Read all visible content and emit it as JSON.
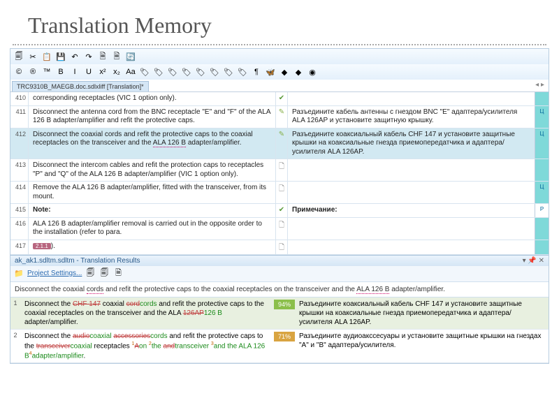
{
  "title": "Translation Memory",
  "file_tab": "TRC9310B_MAEGB.doc.sdlxliff [Translation]*",
  "toolbar_icons": [
    "🗐",
    "✂",
    "📋",
    "💾",
    "↶",
    "↷",
    "🗎",
    "🗎",
    "🔄",
    "©",
    "®",
    "™",
    "B",
    "I",
    "U",
    "x²",
    "x₂",
    "Aa",
    "🏷",
    "🏷",
    "🏷",
    "🏷",
    "🏷",
    "🏷",
    "🏷",
    "🏷",
    "¶",
    "🦋",
    "◆",
    "◆",
    "◉"
  ],
  "rows": [
    {
      "num": "410",
      "src": "corresponding receptacles (VIC 1 option only).",
      "mark": "✔",
      "tgt": "",
      "stat": ""
    },
    {
      "num": "411",
      "src": "Disconnect the antenna cord from the BNC receptacle \"E\" and \"F\" of the ALA 126 B adapter/amplifier and refit the protective caps.",
      "mark": "✎",
      "tgt": "Разъедините кабель антенны с гнездом BNC \"E\" адаптера/усилителя ALA 126AP и установите защитную крышку.",
      "stat": "Ц",
      "alt": false
    },
    {
      "num": "412",
      "src": "Disconnect the coaxial cords and refit the protective caps to the coaxial receptacles on the transceiver and the <u>ALA 126 B</u> adapter/amplifier.",
      "mark": "✎",
      "tgt": "Разъедините коаксиальный кабель CHF 147 и установите защитные крышки на коаксиальные гнезда приемопередатчика и адаптера/усилителя ALA 126AP.",
      "stat": "Ц",
      "alt": true
    },
    {
      "num": "413",
      "src": "Disconnect the intercom cables and refit the protection caps to receptacles \"P\" and \"Q\" of the ALA 126 B adapter/amplifier (VIC 1 option only).",
      "mark": "🗋",
      "tgt": "",
      "stat": "",
      "alt": false
    },
    {
      "num": "414",
      "src": "Remove the ALA 126 B adapter/amplifier, fitted with the transceiver, from its mount.",
      "mark": "🗋",
      "tgt": "",
      "stat": "Ц",
      "alt": false
    },
    {
      "num": "415",
      "src": "<b>Note:</b>",
      "mark": "✔",
      "tgt": "<b>Примечание:</b>",
      "stat": "P",
      "alt": false,
      "pstat": true
    },
    {
      "num": "416",
      "src": "ALA 126 B adapter/amplifier removal is carried out in the opposite order to the installation (refer to para.",
      "mark": "🗋",
      "tgt": "",
      "stat": "",
      "alt": false
    },
    {
      "num": "417",
      "src": "<tag>2.1.1</tag>).",
      "mark": "🗋",
      "tgt": "",
      "stat": "",
      "alt": false
    }
  ],
  "results": {
    "header": "ak_ak1.sdltm.sdltm - Translation Results",
    "proj_settings": "Project Settings...",
    "source_line": "Disconnect the coaxial <u>cords</u> and refit the protective caps to the coaxial receptacles on the transceiver and the <u>ALA 126 B</u> adapter/amplifier.",
    "matches": [
      {
        "n": "1",
        "pct": "94%",
        "pcls": "pct94",
        "src": "Disconnect the <s>CHF 147</s> coaxial <s>cord</s><i>cords</i> and refit the protective caps to the coaxial receptacles on the transceiver and the ALA <s>126AP</s><i>126 B</i> adapter/amplifier.",
        "tgt": "Разъедините коаксиальный кабель CHF 147 и установите защитные крышки на коаксиальные гнезда приемопередатчика и адаптера/усилителя ALA 126AP.",
        "alt": true
      },
      {
        "n": "2",
        "pct": "71%",
        "pcls": "pct71",
        "src": "Disconnect the <s>audio</s><i>coaxial</i> <s>accessories</s><i>cords</i> and refit the protective caps to the <s>transceiver</s><i>coaxial</i> receptacles <sup>1</sup><s>A</s><i>on </i><sup>2</sup><i>the </i><s>and</s><i>transceiver </i><sup>3</sup><i>and the ALA 126 B</i><sup>4</sup><i>adapter/amplifier</i>.",
        "tgt": "Разъедините аудиоакссесуары и установите защитные крышки на гнездах \"A\" и \"B\" адаптера/усилителя.",
        "alt": false
      }
    ]
  }
}
